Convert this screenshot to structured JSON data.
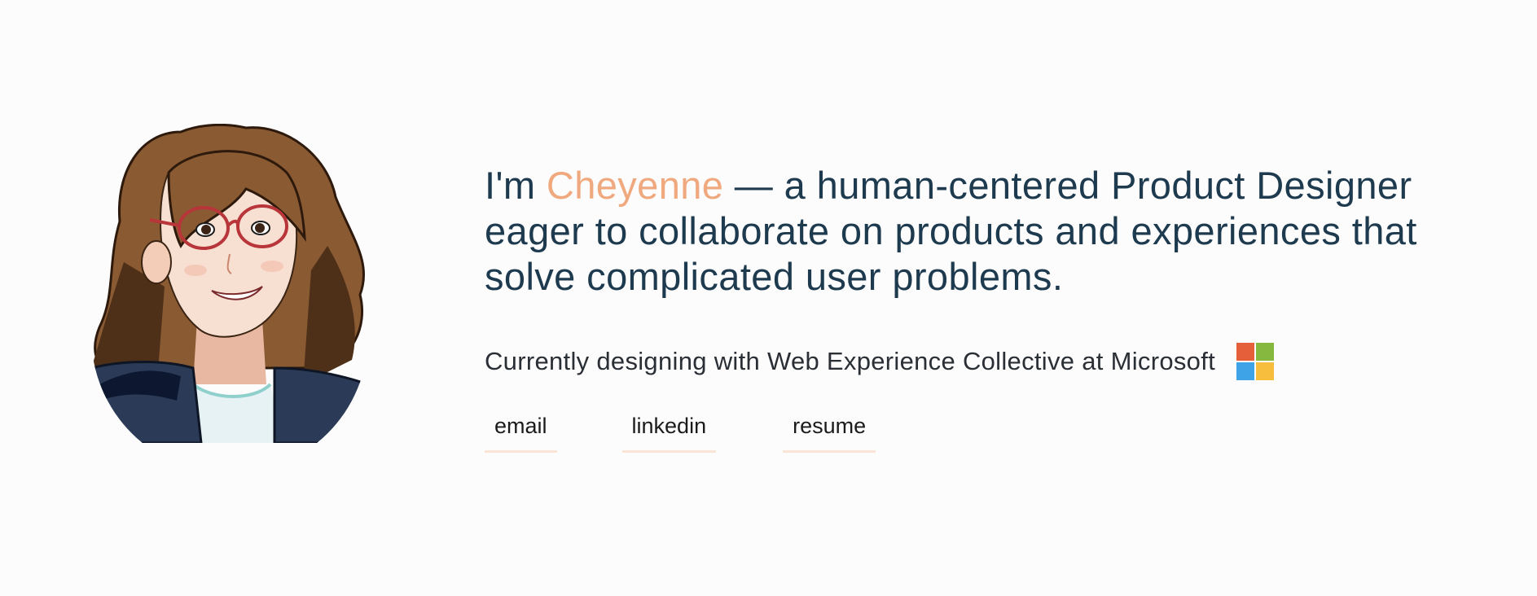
{
  "intro": {
    "prefix": "I'm",
    "name": "Cheyenne",
    "rest_line1": " — a human-centered Product Designer",
    "line2": "eager to collaborate on products and experiences that",
    "line3": "solve complicated user problems."
  },
  "current": {
    "text": "Currently designing with Web Experience Collective at Microsoft",
    "logo_icon": "microsoft-logo-icon"
  },
  "links": {
    "email": "email",
    "linkedin": "linkedin",
    "resume": "resume"
  },
  "colors": {
    "name_accent": "#f0a97e",
    "headline": "#1d3a4f",
    "link_underline": "#fbe3d6",
    "ms_red": "#e5603a",
    "ms_green": "#86b840",
    "ms_blue": "#3ea3e7",
    "ms_yellow": "#f7bd3c"
  }
}
